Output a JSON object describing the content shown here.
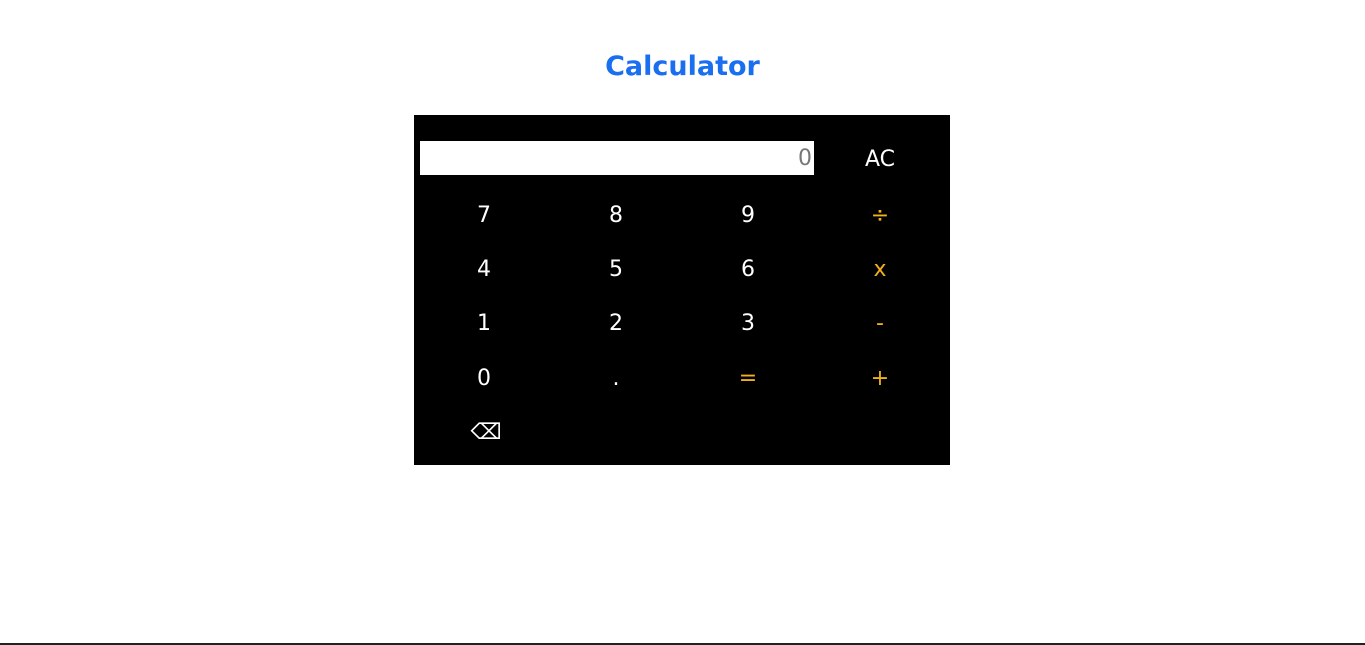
{
  "title": "Calculator",
  "display": {
    "value": "",
    "placeholder": "0"
  },
  "buttons": {
    "ac": "AC",
    "seven": "7",
    "eight": "8",
    "nine": "9",
    "divide": "÷",
    "four": "4",
    "five": "5",
    "six": "6",
    "multiply": "x",
    "one": "1",
    "two": "2",
    "three": "3",
    "subtract": "-",
    "zero": "0",
    "decimal": ".",
    "equals": "=",
    "add": "+",
    "backspace": "⌫"
  },
  "colors": {
    "title": "#1a6ef0",
    "panel": "#000000",
    "digit": "#ffffff",
    "operator": "#f2b01c"
  }
}
